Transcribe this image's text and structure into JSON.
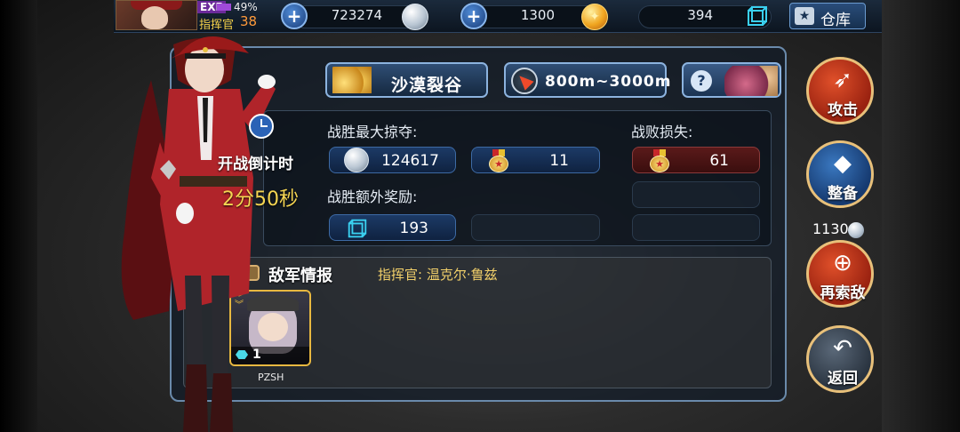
{
  "player": {
    "exp_label": "EXP",
    "exp_percent": "49%",
    "rank": "指挥官",
    "level": "38"
  },
  "resources": {
    "silver": "723274",
    "gold": "1300",
    "crystal": "394",
    "warehouse_label": "仓库"
  },
  "battle": {
    "location": "沙漠裂谷",
    "range": "800m~3000m",
    "help_symbol": "?",
    "countdown_label": "开战倒计时",
    "countdown_value": "2分50秒",
    "max_loot_label": "战胜最大掠夺:",
    "max_loot_silver": "124617",
    "max_loot_medals": "11",
    "loss_label": "战败损失:",
    "loss_medals": "61",
    "extra_reward_label": "战胜额外奖励:",
    "extra_reward_crystal": "193"
  },
  "enemy": {
    "title": "敌军情报",
    "commander": "指挥官: 温克尔·鲁兹",
    "unit_level": "1",
    "unit_name": "PZSH"
  },
  "actions": {
    "attack": "攻击",
    "organize": "整备",
    "search_cost": "1130",
    "research": "再索敌",
    "back": "返回"
  },
  "colors": {
    "accent_gold": "#f5d552",
    "loss_red": "#5a1a1a",
    "panel_border": "#6a8aab"
  }
}
